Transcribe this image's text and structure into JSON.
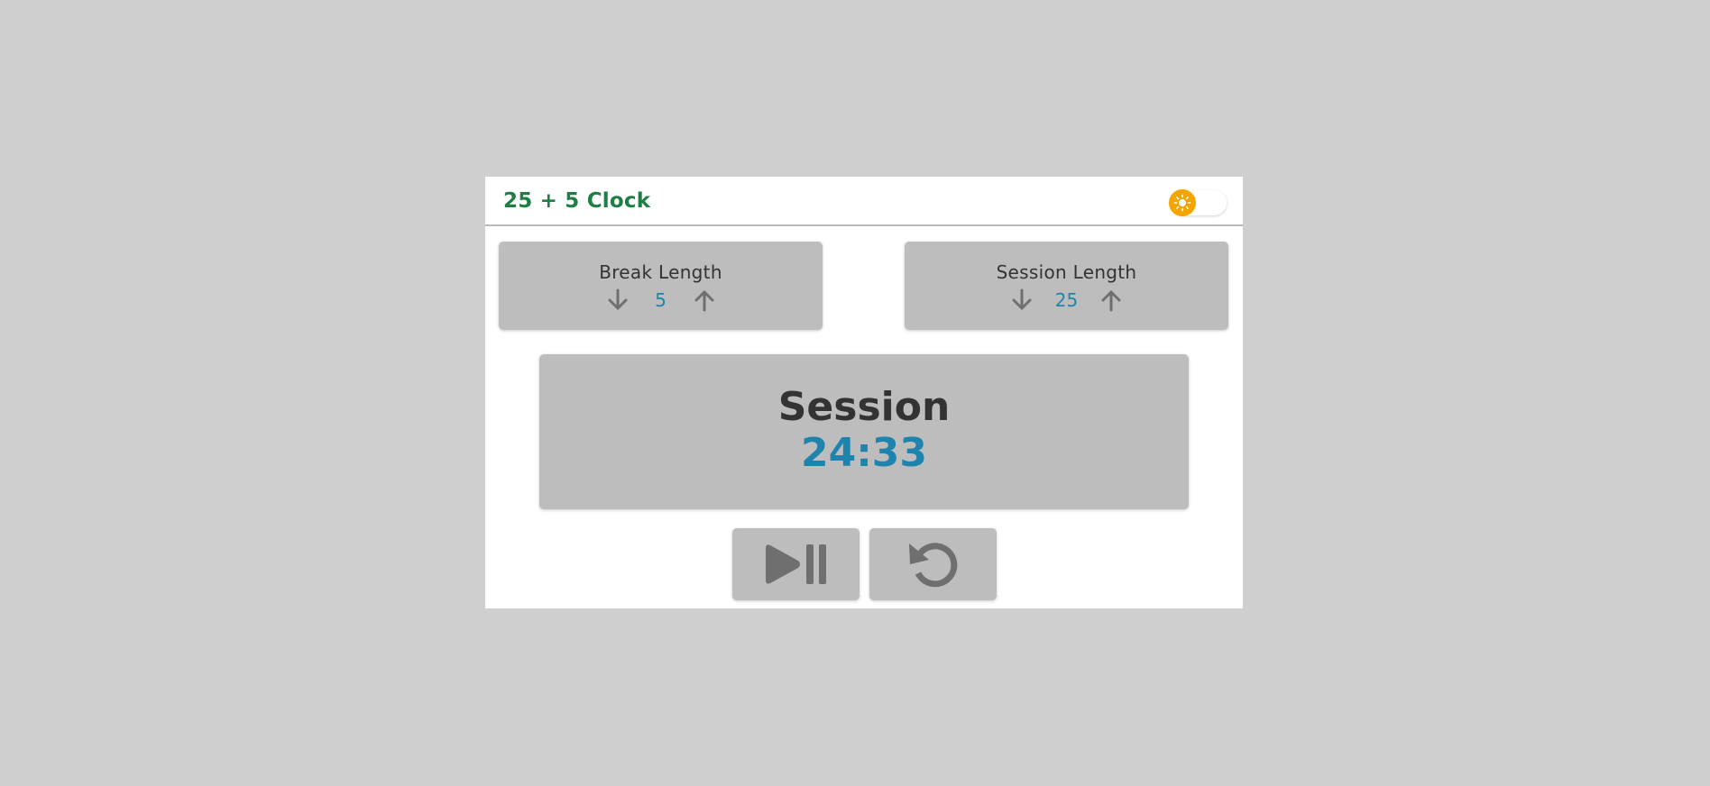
{
  "app": {
    "title": "25 + 5 Clock",
    "theme_toggle": {
      "state": "light",
      "icon": "sun-icon",
      "knob_color": "#f5a500"
    }
  },
  "break": {
    "label": "Break Length",
    "value": "5",
    "decrement_icon": "arrow-down-icon",
    "increment_icon": "arrow-up-icon"
  },
  "session": {
    "label": "Session Length",
    "value": "25",
    "decrement_icon": "arrow-down-icon",
    "increment_icon": "arrow-up-icon"
  },
  "timer": {
    "label": "Session",
    "time": "24:33"
  },
  "controls": {
    "play_pause_icon": "play-pause-icon",
    "reset_icon": "reset-icon"
  },
  "colors": {
    "background": "#d0cfd0",
    "panel": "#ffffff",
    "card": "#bdbdbd",
    "title_green": "#1e7f45",
    "value_blue": "#1f84ad",
    "text_dark": "#333333",
    "icon_gray": "#6f6f6f",
    "toggle_orange": "#f5a500"
  }
}
